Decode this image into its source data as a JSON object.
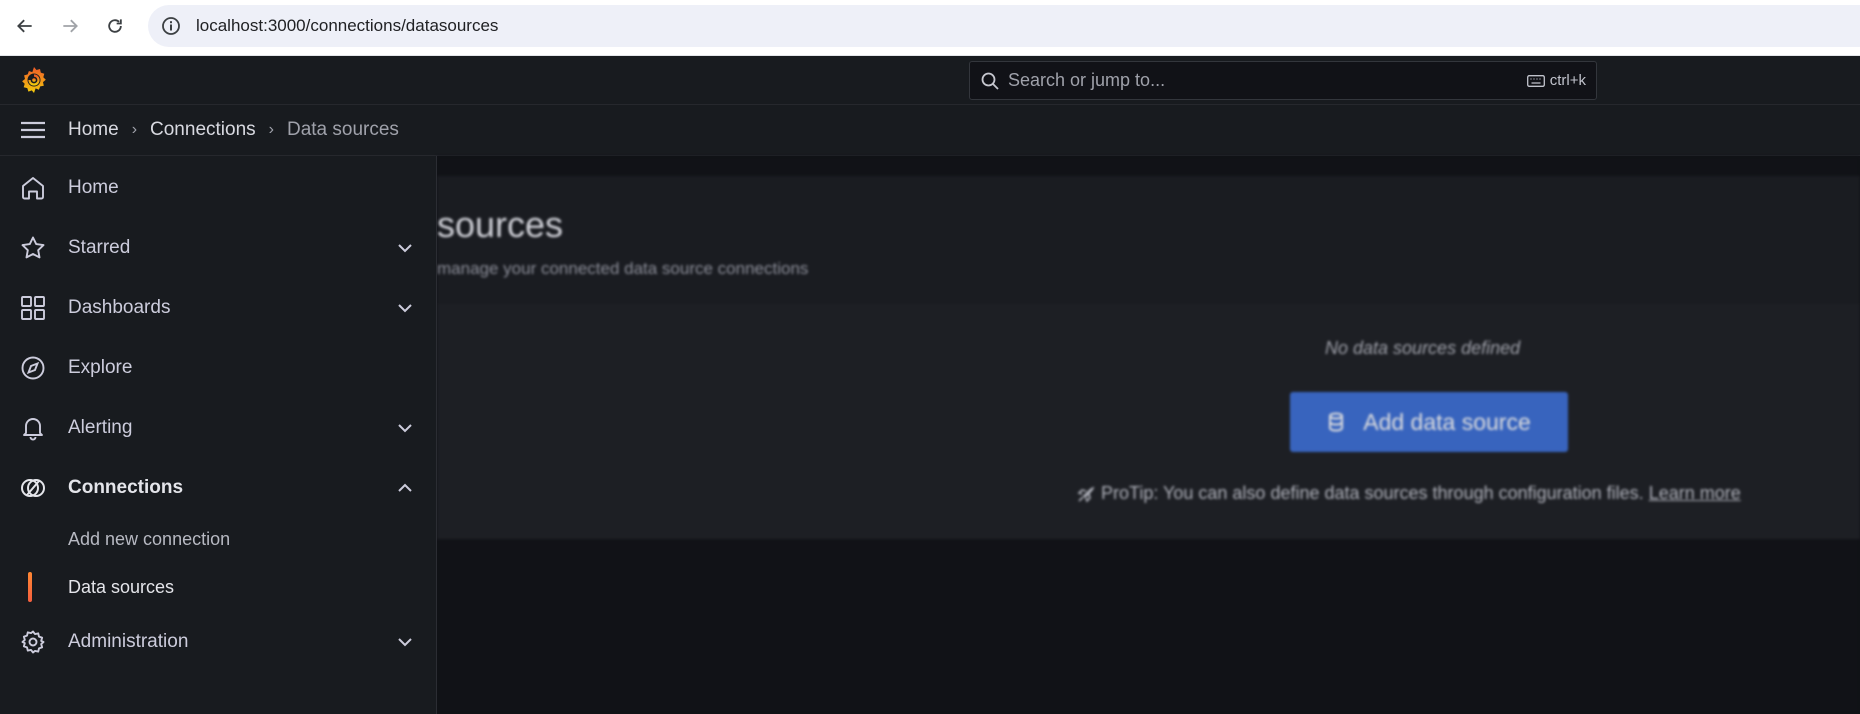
{
  "browser": {
    "url": "localhost:3000/connections/datasources"
  },
  "topbar": {
    "search_placeholder": "Search or jump to...",
    "shortcut": "ctrl+k"
  },
  "breadcrumb": {
    "items": [
      "Home",
      "Connections",
      "Data sources"
    ],
    "separator": "›"
  },
  "sidebar": {
    "items": [
      {
        "label": "Home",
        "icon": "home-icon"
      },
      {
        "label": "Starred",
        "icon": "star-icon"
      },
      {
        "label": "Dashboards",
        "icon": "dashboards-icon"
      },
      {
        "label": "Explore",
        "icon": "compass-icon"
      },
      {
        "label": "Alerting",
        "icon": "bell-icon"
      },
      {
        "label": "Connections",
        "icon": "connections-icon"
      },
      {
        "label": "Administration",
        "icon": "gear-icon"
      }
    ],
    "connections_children": [
      "Add new connection",
      "Data sources"
    ],
    "active_child": "Data sources"
  },
  "main": {
    "title_visible": "sources",
    "subtitle_visible": "manage your connected data source connections",
    "empty_message": "No data sources defined",
    "add_button": "Add data source",
    "protip": "ProTip: You can also define data sources through configuration files.",
    "learn_more": "Learn more"
  },
  "colors": {
    "accent_orange": "#f55f3e",
    "primary_blue": "#3d71d9",
    "background": "#111217",
    "panel": "#181b1f"
  }
}
